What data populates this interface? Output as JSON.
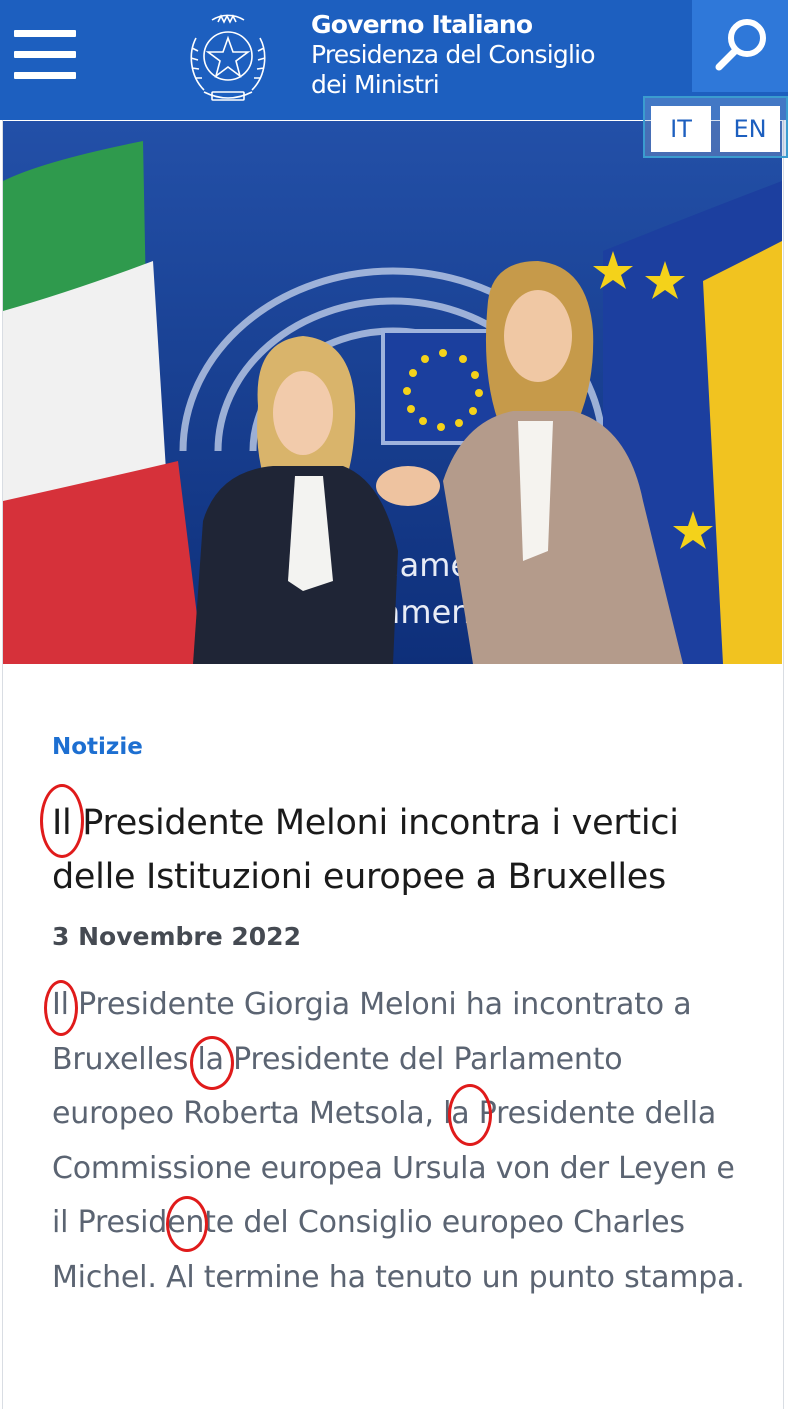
{
  "header": {
    "menu_icon": "hamburger-menu-icon",
    "emblem_icon": "italian-republic-emblem",
    "brand_title": "Governo Italiano",
    "brand_sub_line1": "Presidenza del Consiglio",
    "brand_sub_line2": "dei Ministri",
    "search_icon": "search-icon",
    "languages": [
      "IT",
      "EN"
    ],
    "colors": {
      "header_bg": "#1d5fbf",
      "search_bg": "#2f78d9"
    }
  },
  "article": {
    "hero_image": "photo-meloni-metsola-handshake",
    "category": "Notizie",
    "title": "Il Presidente Meloni incontra i vertici delle Istituzioni europee a Bruxelles",
    "date": "3 Novembre 2022",
    "body": "Il Presidente Giorgia Meloni ha incontrato a Bruxelles la Presidente del Parlamento europeo Roberta Metsola, la Presidente della Commissione europea Ursula von der Leyen e il Presidente del Consiglio europeo Charles Michel. Al termine ha tenuto un punto stampa."
  },
  "colors": {
    "category": "#1d6fd1",
    "annotation_circle": "#e01b1b"
  }
}
